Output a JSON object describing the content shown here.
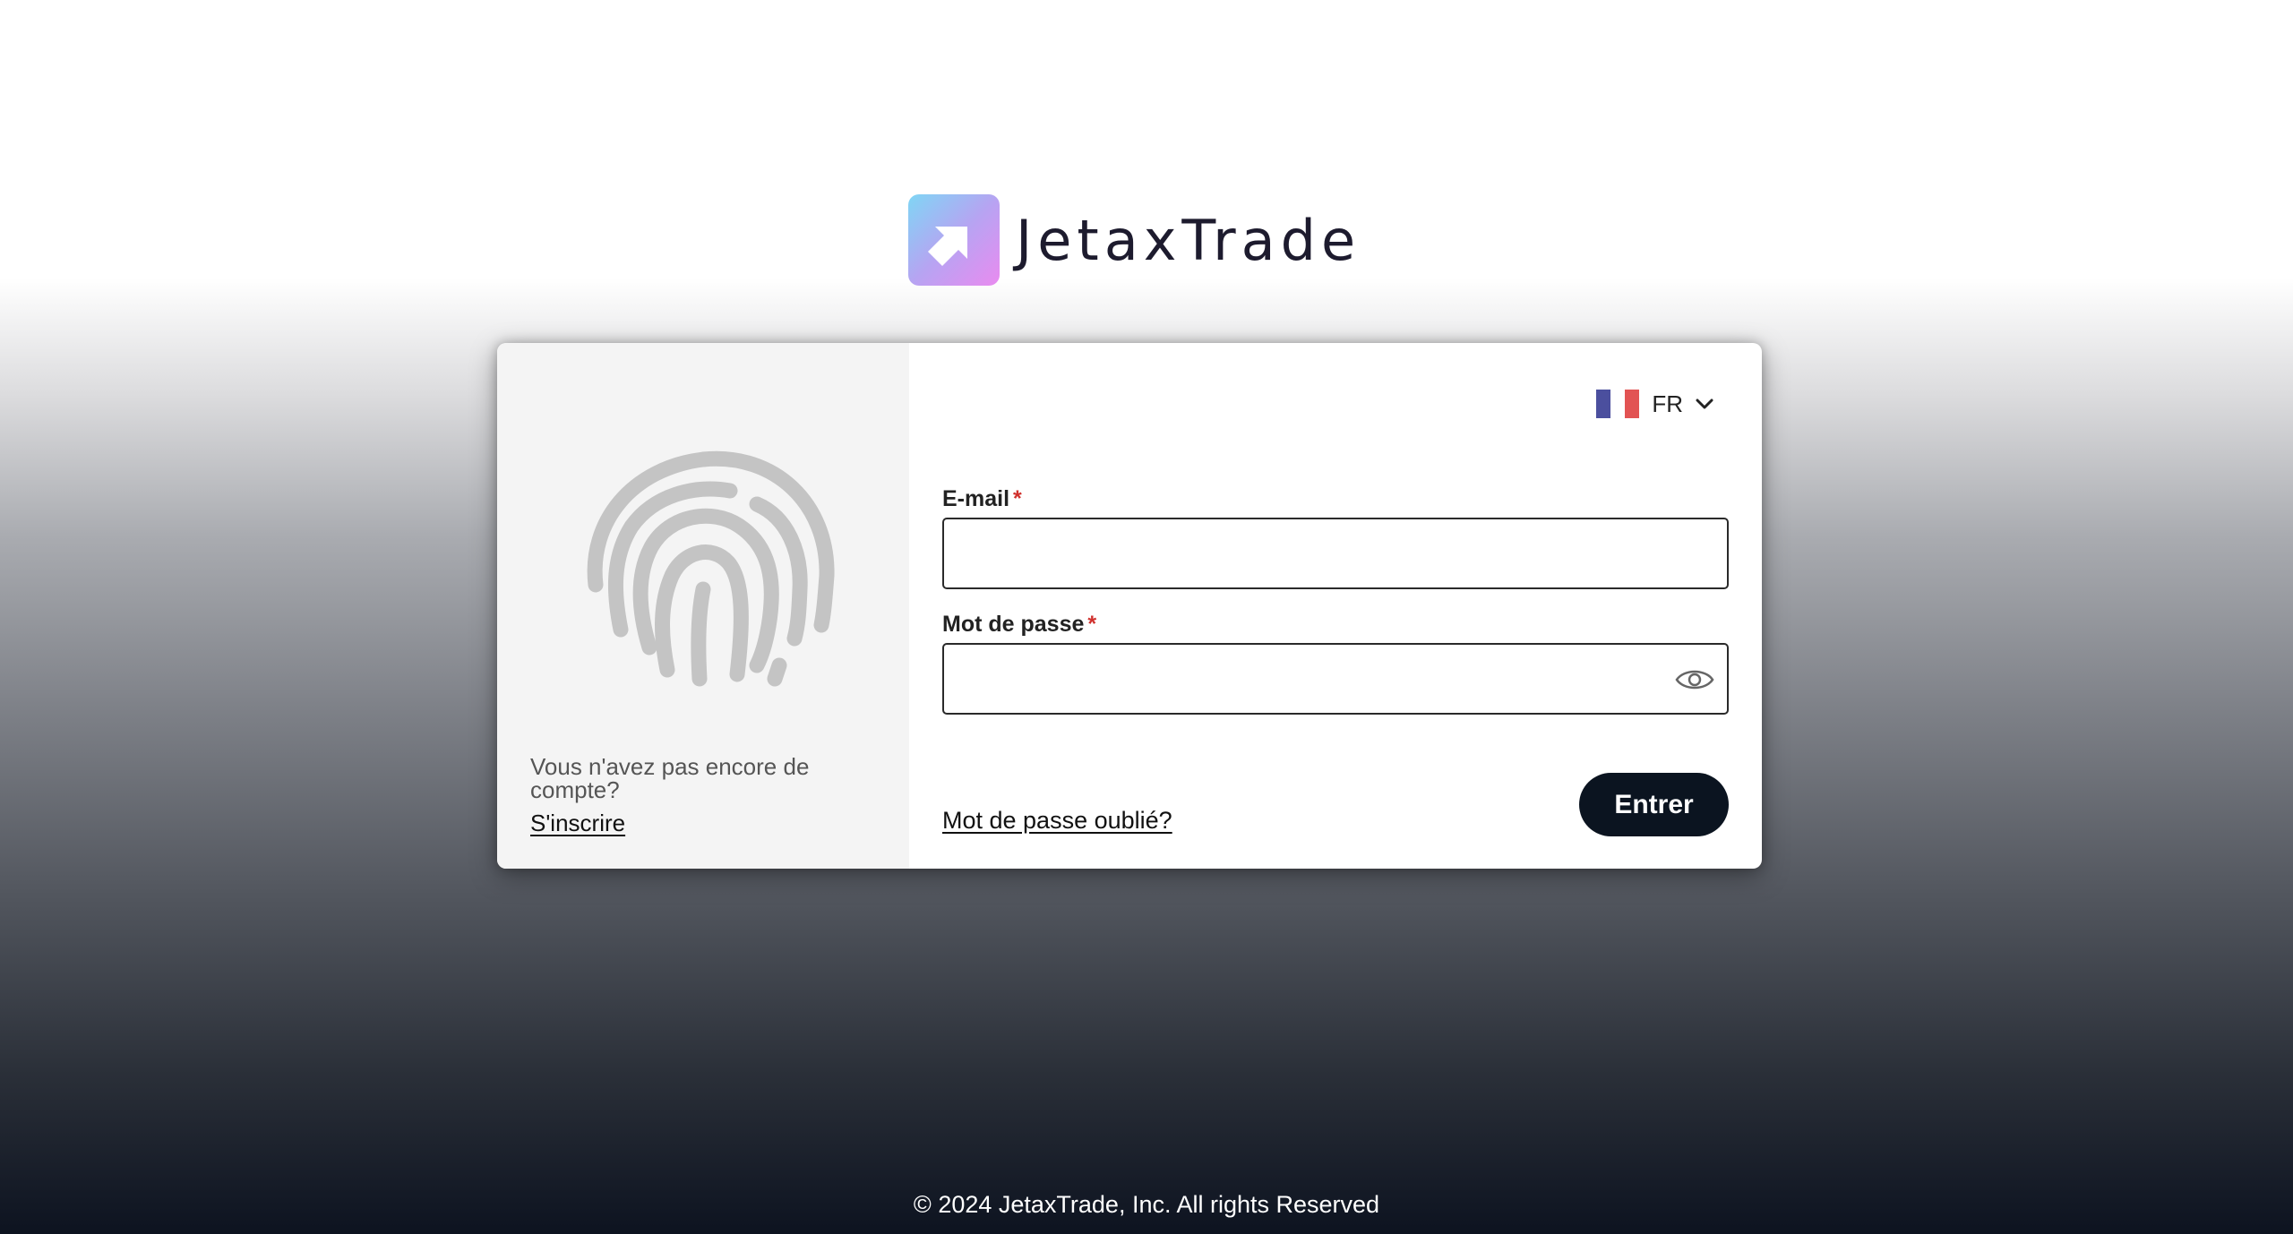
{
  "brand": {
    "name": "JetaxTrade",
    "icon": "arrow-up-right-logo-icon",
    "gradient": [
      "#7fd6f5",
      "#b6a4f2",
      "#e98bf0"
    ]
  },
  "left_panel": {
    "icon": "fingerprint-icon",
    "no_account_text": "Vous n'avez pas encore de compte?",
    "signup_link": "S'inscrire"
  },
  "language": {
    "code": "FR",
    "flag_icon": "france-flag-icon",
    "flag_colors": [
      "#4b4f9e",
      "#ffffff",
      "#e25353"
    ]
  },
  "form": {
    "email_label": "E-mail",
    "password_label": "Mot de passe",
    "required_marker": "*",
    "email_value": "",
    "password_value": "",
    "show_password_icon": "eye-icon",
    "forgot_link": "Mot de passe oublié?",
    "submit_label": "Entrer"
  },
  "footer": {
    "copyright": "© 2024 JetaxTrade, Inc. All rights Reserved"
  },
  "colors": {
    "button_bg": "#0b1420",
    "required": "#d0312d"
  }
}
